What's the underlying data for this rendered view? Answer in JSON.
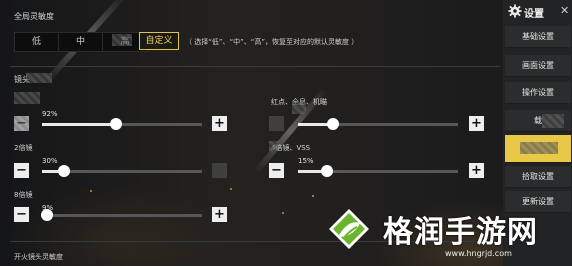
{
  "global": {
    "title": "全局灵敏度",
    "options": [
      "低",
      "中",
      "高"
    ],
    "selected_label": "自定义",
    "hint": "（ 选择“低”、“中”、“高”，恢复至对应的默认灵敏度 ）"
  },
  "scope": {
    "title": "镜头",
    "sliders": [
      {
        "label": "",
        "percent_label": "92%",
        "value": 92
      },
      {
        "label": "红点、全息、机瞄",
        "percent_label": "",
        "value": 48
      },
      {
        "label": "2倍镜",
        "percent_label": "30%",
        "value": 30
      },
      {
        "label": "4倍镜、VSS",
        "percent_label": "15%",
        "value": 15
      },
      {
        "label": "8倍镜",
        "percent_label": "9%",
        "value": 9
      }
    ]
  },
  "fire_title": "开火镜头灵敏度",
  "sidebar": {
    "title": "设置",
    "items": [
      {
        "label": "基础设置",
        "active": false
      },
      {
        "label": "画面设置",
        "active": false
      },
      {
        "label": "操作设置",
        "active": false
      },
      {
        "label": "载",
        "active": false
      },
      {
        "label": "",
        "active": true
      },
      {
        "label": "拾取设置",
        "active": false
      },
      {
        "label": "更新设置",
        "active": false
      }
    ]
  },
  "watermark": {
    "brand": "格润手游网",
    "url": "www.hngrjd.com"
  },
  "colors": {
    "accent": "#e9c747",
    "selected_border": "#e0c24e",
    "watermark_green": "#6bb42c"
  },
  "icons": {
    "gear": "gear-icon",
    "close": "close-icon",
    "plus": "plus-icon",
    "minus": "minus-icon",
    "logo": "leaf-logo-icon"
  }
}
